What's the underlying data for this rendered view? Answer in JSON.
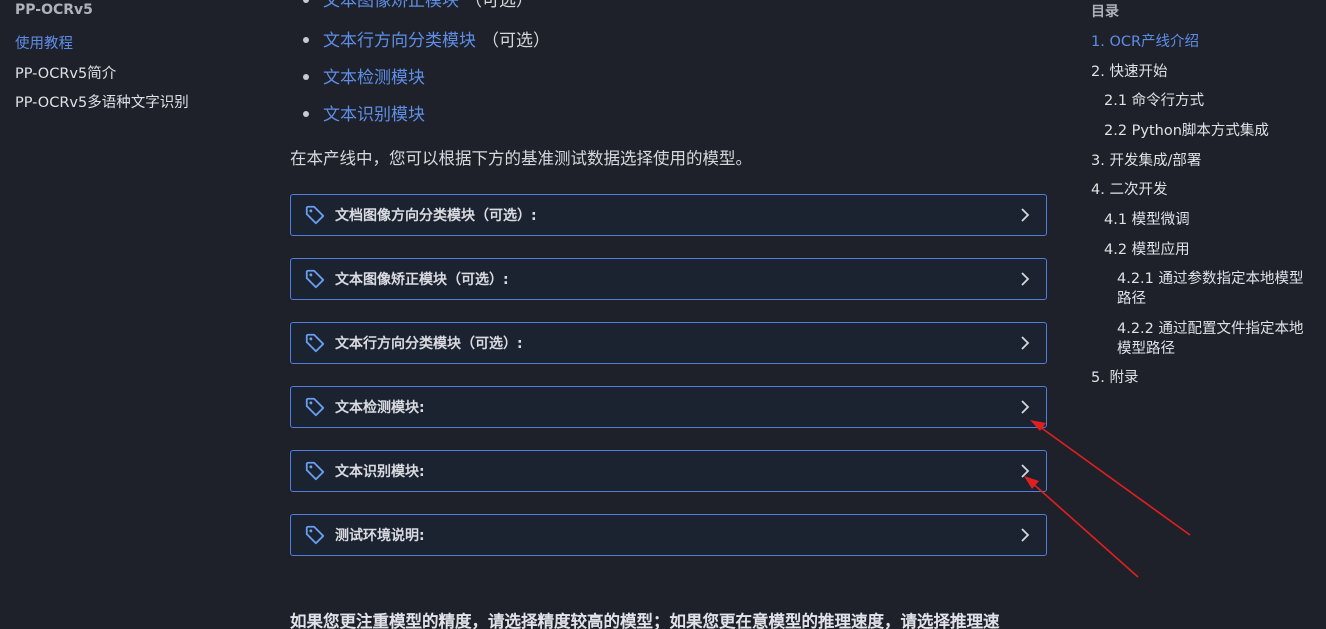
{
  "left_nav": {
    "title": "PP-OCRv5",
    "items": [
      "使用教程",
      "PP-OCRv5简介",
      "PP-OCRv5多语种文字识别"
    ]
  },
  "main": {
    "bullets": [
      {
        "link": "文本图像矫正模块",
        "suffix": "（可选）"
      },
      {
        "link": "文本行方向分类模块",
        "suffix": "（可选）"
      },
      {
        "link": "文本检测模块",
        "suffix": ""
      },
      {
        "link": "文本识别模块",
        "suffix": ""
      }
    ],
    "intro": "在本产线中，您可以根据下方的基准测试数据选择使用的模型。",
    "accordions": [
      "文档图像方向分类模块（可选）:",
      "文本图像矫正模块（可选）:",
      "文本行方向分类模块（可选）:",
      "文本检测模块:",
      "文本识别模块:",
      "测试环境说明:"
    ],
    "bottom_text": "如果您更注重模型的精度，请选择精度较高的模型；如果您更在意模型的推理速度，请选择推理速"
  },
  "toc": {
    "heading": "目录",
    "items": [
      "1. OCR产线介绍",
      "2. 快速开始",
      "2.1 命令行方式",
      "2.2 Python脚本方式集成",
      "3. 开发集成/部署",
      "4. 二次开发",
      "4.1 模型微调",
      "4.2 模型应用",
      "4.2.1 通过参数指定本地模型路径",
      "4.2.2 通过配置文件指定本地模型路径",
      "5. 附录"
    ]
  },
  "colors": {
    "background": "#1e2129",
    "accent": "#5e8ee8",
    "accordion_border": "#4f7fd9",
    "annotation_arrow": "#e02020"
  }
}
